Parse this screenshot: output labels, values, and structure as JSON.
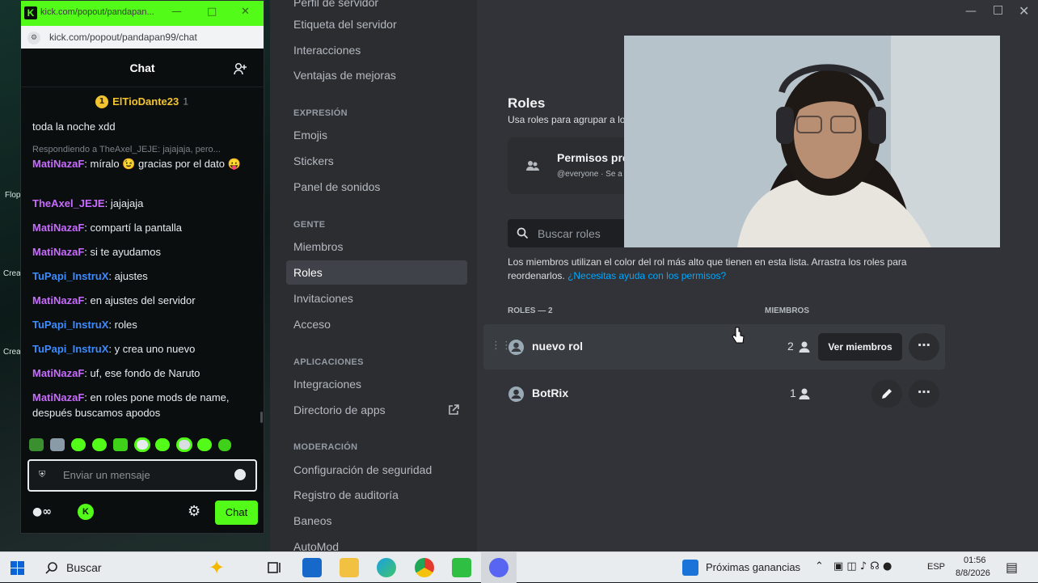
{
  "kick": {
    "window_title": "kick.com/popout/pandapan...",
    "url": "kick.com/popout/pandapan99/chat",
    "header_title": "Chat",
    "pinned_user": "ElTioDante23",
    "pinned_count": "1",
    "messages": [
      {
        "text": "toda la noche xdd"
      },
      {
        "reply": "Respondiendo a TheAxel_JEJE: jajajaja, pero..."
      },
      {
        "user": "MatiNazaF",
        "text": ": míralo 😉 gracias por el dato 😛"
      },
      {
        "user": "TheAxel_JEJE",
        "text": ": jajajaja"
      },
      {
        "user": "MatiNazaF",
        "text": ": compartí la pantalla"
      },
      {
        "user": "MatiNazaF",
        "text": ": si te ayudamos"
      },
      {
        "user": "TuPapi_InstruX",
        "text": ": ajustes"
      },
      {
        "user": "MatiNazaF",
        "text": ": en ajustes del servidor"
      },
      {
        "user": "TuPapi_InstruX",
        "text": ": roles"
      },
      {
        "user": "TuPapi_InstruX",
        "text": ": y crea uno nuevo"
      },
      {
        "user": "MatiNazaF",
        "text": ": uf, ese fondo de Naruto"
      },
      {
        "user": "MatiNazaF",
        "text": ": en roles pone mods de name, después buscamos apodos"
      }
    ],
    "input_placeholder": "Enviar un mensaje",
    "chat_button": "Chat",
    "accent": "#53fc18"
  },
  "desktop": {
    "label1": "Flop",
    "label2": "Crea",
    "label3": "Crea"
  },
  "discord": {
    "nav_top": [
      "Perfil de servidor",
      "Etiqueta del servidor",
      "Interacciones",
      "Ventajas de mejoras"
    ],
    "section_expresion": "EXPRESIÓN",
    "nav_expresion": [
      "Emojis",
      "Stickers",
      "Panel de sonidos"
    ],
    "section_gente": "GENTE",
    "nav_gente": [
      "Miembros",
      "Roles",
      "Invitaciones",
      "Acceso"
    ],
    "section_apps": "APLICACIONES",
    "nav_apps": [
      "Integraciones",
      "Directorio de apps"
    ],
    "section_mod": "MODERACIÓN",
    "nav_mod": [
      "Configuración de seguridad",
      "Registro de auditoría",
      "Baneos",
      "AutoMod"
    ],
    "page_title": "Roles",
    "page_sub": "Usa roles para agrupar a lo",
    "perm_title": "Permisos pre",
    "perm_sub": "@everyone · Se a",
    "search_placeholder": "Buscar roles",
    "info_text": "Los miembros utilizan el color del rol más alto que tienen en esta lista. Arrastra los roles para reordenarlos.",
    "help_link": "¿Necesitas ayuda con los permisos?",
    "col_roles": "ROLES — 2",
    "col_members": "MIEMBROS",
    "roles": [
      {
        "name": "nuevo rol",
        "count": "2"
      },
      {
        "name": "BotRix",
        "count": "1"
      }
    ],
    "view_members": "Ver miembros",
    "link_color": "#00a8fc"
  },
  "taskbar": {
    "search": "Buscar",
    "news": "Próximas ganancias",
    "lang": "ESP",
    "time": "01:56",
    "date": "8/8/2026"
  }
}
